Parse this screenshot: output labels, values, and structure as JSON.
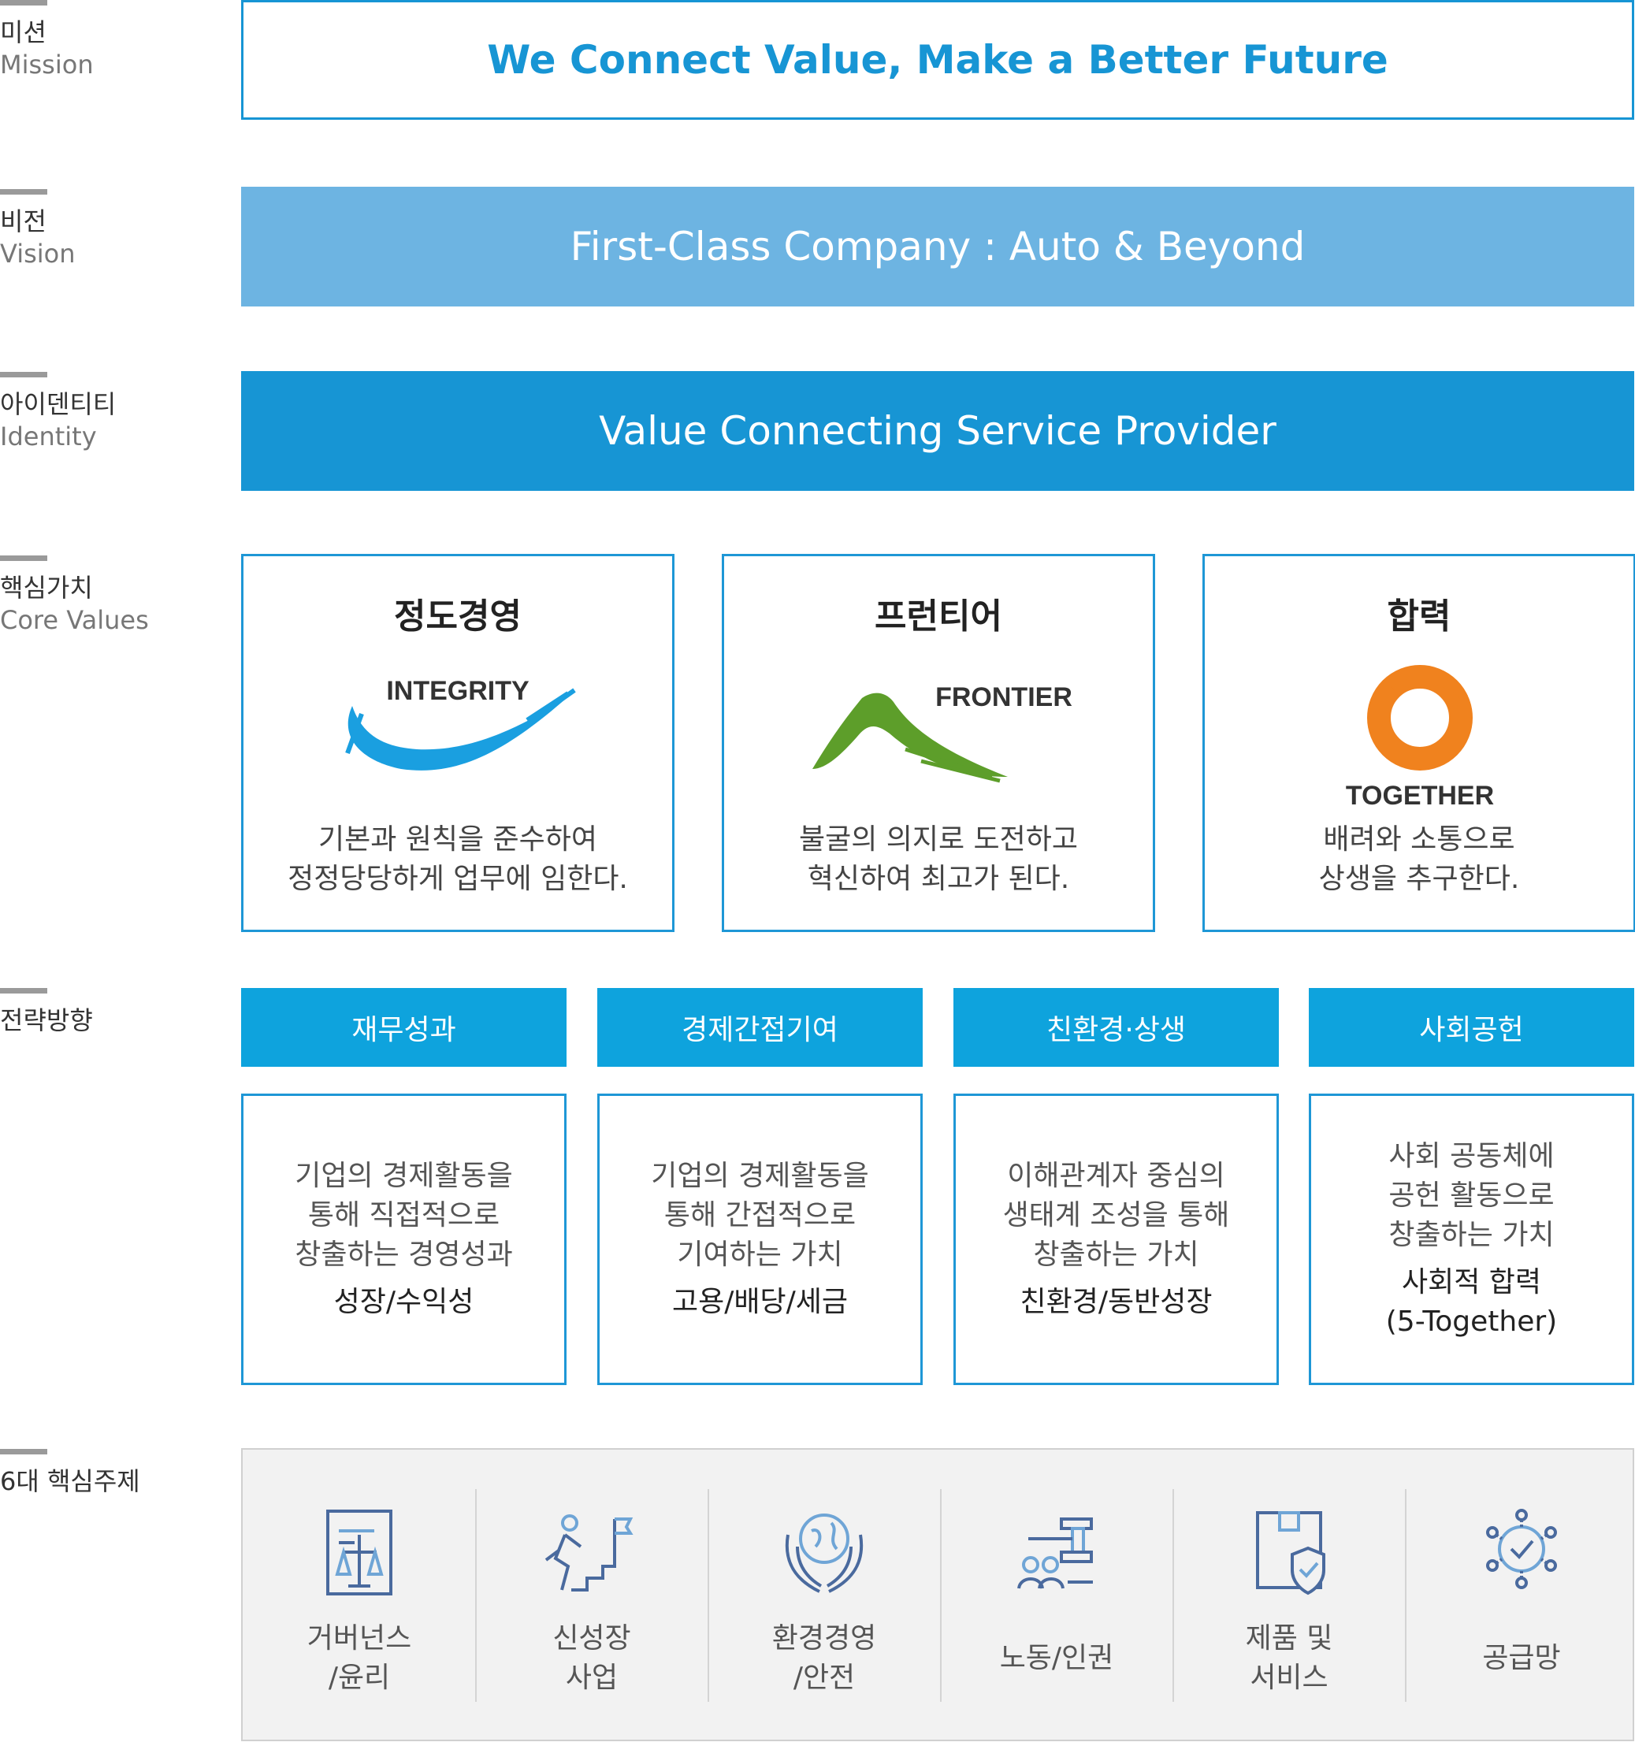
{
  "rows": {
    "mission": {
      "ko": "미션",
      "en": "Mission"
    },
    "vision": {
      "ko": "비전",
      "en": "Vision"
    },
    "identity": {
      "ko": "아이덴티티",
      "en": "Identity"
    },
    "core_values": {
      "ko": "핵심가치",
      "en": "Core Values"
    },
    "strategy": {
      "ko": "전략방향"
    },
    "topics": {
      "ko": "6대 핵심주제"
    }
  },
  "mission_text": "We Connect Value, Make a Better Future",
  "vision_text": "First-Class Company : Auto & Beyond",
  "identity_text": "Value Connecting Service Provider",
  "core_values": [
    {
      "title": "정도경영",
      "logo_text": "INTEGRITY",
      "desc_line1": "기본과 원칙을 준수하여",
      "desc_line2": "정정당당하게 업무에 임한다.",
      "color": "#1a9fe0"
    },
    {
      "title": "프런티어",
      "logo_text": "FRONTIER",
      "desc_line1": "불굴의 의지로 도전하고",
      "desc_line2": "혁신하여 최고가 된다.",
      "color": "#5d9e2a"
    },
    {
      "title": "합력",
      "logo_text": "TOGETHER",
      "desc_line1": "배려와 소통으로",
      "desc_line2": "상생을 추구한다.",
      "color": "#f0821e"
    }
  ],
  "strategies": [
    {
      "head": "재무성과",
      "desc": [
        "기업의 경제활동을",
        "통해 직접적으로",
        "창출하는 경영성과"
      ],
      "key": [
        "성장/수익성"
      ]
    },
    {
      "head": "경제간접기여",
      "desc": [
        "기업의 경제활동을",
        "통해 간접적으로",
        "기여하는 가치"
      ],
      "key": [
        "고용/배당/세금"
      ]
    },
    {
      "head": "친환경·상생",
      "desc": [
        "이해관계자 중심의",
        "생태계 조성을 통해",
        "창출하는 가치"
      ],
      "key": [
        "친환경/동반성장"
      ]
    },
    {
      "head": "사회공헌",
      "desc": [
        "사회 공동체에",
        "공헌 활동으로",
        "창출하는 가치"
      ],
      "key": [
        "사회적 합력",
        "(5-Together)"
      ]
    }
  ],
  "topics": [
    {
      "label": [
        "거버넌스",
        "/윤리"
      ],
      "icon": "governance-scale-icon"
    },
    {
      "label": [
        "신성장",
        "사업"
      ],
      "icon": "growth-climb-flag-icon"
    },
    {
      "label": [
        "환경경영",
        "/안전"
      ],
      "icon": "globe-hands-icon"
    },
    {
      "label": [
        "노동/인권"
      ],
      "icon": "people-gavel-icon"
    },
    {
      "label": [
        "제품 및",
        "서비스"
      ],
      "icon": "product-shield-icon"
    },
    {
      "label": [
        "공급망"
      ],
      "icon": "network-check-icon"
    }
  ],
  "colors": {
    "accent": "#1795d4",
    "vision_bg": "#6db4e2",
    "strategy_head": "#0ea3dd"
  }
}
